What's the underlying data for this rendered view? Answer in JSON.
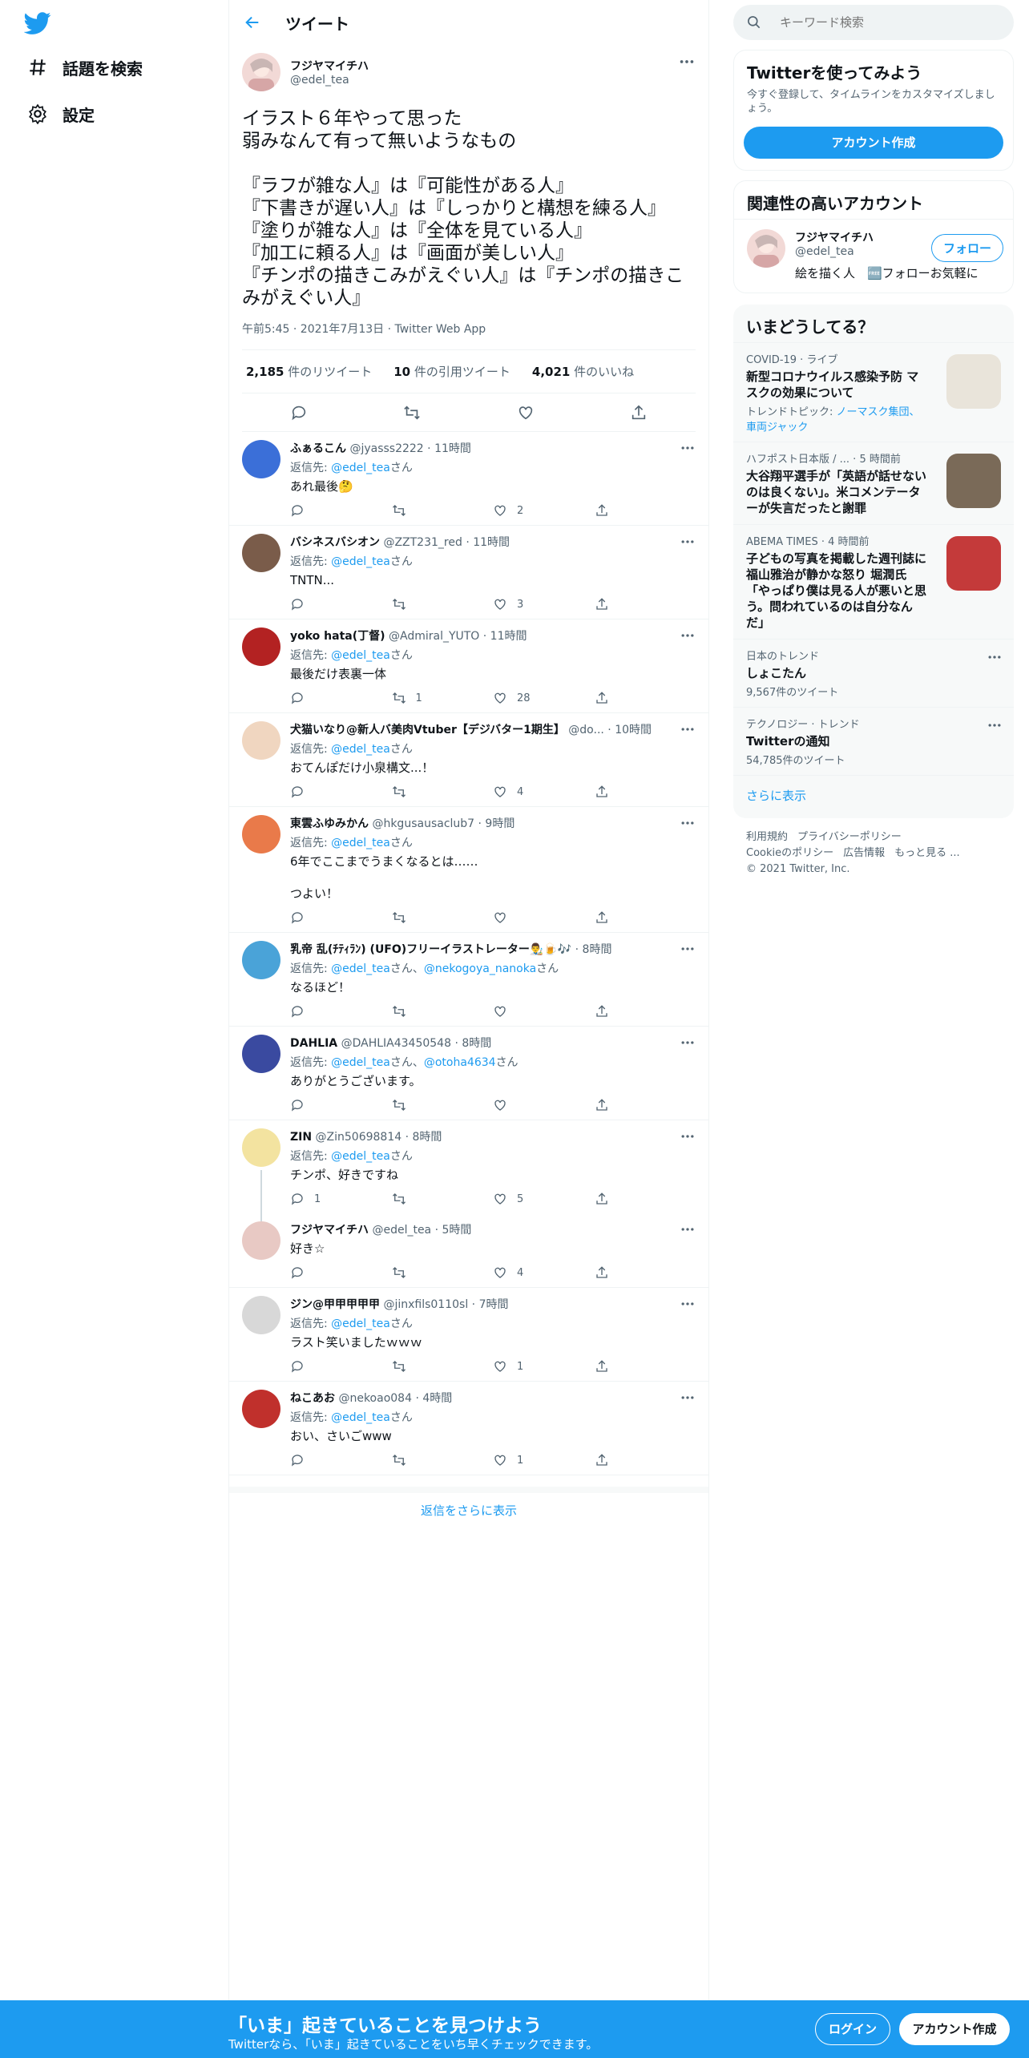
{
  "nav": {
    "explore": "話題を検索",
    "settings": "設定"
  },
  "header": {
    "title": "ツイート"
  },
  "tweet": {
    "display_name": "フジヤマイチハ",
    "handle": "@edel_tea",
    "text": "イラスト６年やって思った\n弱みなんて有って無いようなもの\n\n『ラフが雑な人』は『可能性がある人』\n『下書きが遅い人』は『しっかりと構想を練る人』\n『塗りが雑な人』は『全体を見ている人』\n『加工に頼る人』は『画面が美しい人』\n『チンポの描きこみがえぐい人』は『チンポの描きこみがえぐい人』",
    "timestamp": "午前5:45 · 2021年7月13日 · Twitter Web App",
    "retweets": "2,185",
    "retweets_label": "件のリツイート",
    "quotes": "10",
    "quotes_label": "件の引用ツイート",
    "likes": "4,021",
    "likes_label": "件のいいね"
  },
  "replies": [
    {
      "name": "ふぁるこん",
      "handle": "@jyasss2222",
      "time": "· 11時間",
      "reply_prefix": "返信先:",
      "reply_to": "@edel_tea",
      "reply_to2": "",
      "reply_suffix": "さん",
      "text": "あれ最後🤔",
      "replies": "",
      "retweets": "",
      "likes": "2"
    },
    {
      "name": "バシネスバシオン",
      "handle": "@ZZT231_red",
      "time": "· 11時間",
      "reply_prefix": "返信先:",
      "reply_to": "@edel_tea",
      "reply_to2": "",
      "reply_suffix": "さん",
      "text": "TNTN...",
      "replies": "",
      "retweets": "",
      "likes": "3"
    },
    {
      "name": "yoko hata(丁督)",
      "handle": "@Admiral_YUTO",
      "time": "· 11時間",
      "reply_prefix": "返信先:",
      "reply_to": "@edel_tea",
      "reply_to2": "",
      "reply_suffix": "さん",
      "text": "最後だけ表裏一体",
      "replies": "",
      "retweets": "1",
      "likes": "28"
    },
    {
      "name": "犬猫いなり@新人バ美肉Vtuber【デジバター1期生】",
      "handle": "@do...",
      "time": "· 10時間",
      "reply_prefix": "返信先:",
      "reply_to": "@edel_tea",
      "reply_to2": "",
      "reply_suffix": "さん",
      "text": "おてんぽだけ小泉構文...！",
      "replies": "",
      "retweets": "",
      "likes": "4"
    },
    {
      "name": "東雲ふゆみかん",
      "handle": "@hkgusausaclub7",
      "time": "· 9時間",
      "reply_prefix": "返信先:",
      "reply_to": "@edel_tea",
      "reply_to2": "",
      "reply_suffix": "さん",
      "text": "6年でここまでうまくなるとは……\n\nつよい！",
      "replies": "",
      "retweets": "",
      "likes": ""
    },
    {
      "name": "乳帝 乱(ﾁﾃｨﾗﾝ) (UFO)フリーイラストレーター👨‍🎨🍺🎶",
      "handle": "",
      "time": "· 8時間",
      "reply_prefix": "返信先:",
      "reply_to": "@edel_tea",
      "reply_to2": "@nekogoya_nanoka",
      "reply_suffix": "さん",
      "text": "なるほど！",
      "replies": "",
      "retweets": "",
      "likes": ""
    },
    {
      "name": "DAHLIA",
      "handle": "@DAHLIA43450548",
      "time": "· 8時間",
      "reply_prefix": "返信先:",
      "reply_to": "@edel_tea",
      "reply_to2": "@otoha4634",
      "reply_suffix": "さん",
      "text": "ありがとうございます。",
      "replies": "",
      "retweets": "",
      "likes": ""
    },
    {
      "name": "ZIN",
      "handle": "@Zin50698814",
      "time": "· 8時間",
      "reply_prefix": "返信先:",
      "reply_to": "@edel_tea",
      "reply_to2": "",
      "reply_suffix": "さん",
      "text": "チンポ、好きですね",
      "replies": "1",
      "retweets": "",
      "likes": "5"
    },
    {
      "name": "フジヤマイチハ",
      "handle": "@edel_tea",
      "time": "· 5時間",
      "reply_prefix": "",
      "reply_to": "",
      "reply_to2": "",
      "reply_suffix": "",
      "text": "好き☆",
      "replies": "",
      "retweets": "",
      "likes": "4"
    },
    {
      "name": "ジン@甲甲甲甲甲",
      "handle": "@jinxfils0110sl",
      "time": "· 7時間",
      "reply_prefix": "返信先:",
      "reply_to": "@edel_tea",
      "reply_to2": "",
      "reply_suffix": "さん",
      "text": "ラスト笑いましたｗｗｗ",
      "replies": "",
      "retweets": "",
      "likes": "1"
    },
    {
      "name": "ねこあお",
      "handle": "@nekoao084",
      "time": "· 4時間",
      "reply_prefix": "返信先:",
      "reply_to": "@edel_tea",
      "reply_to2": "",
      "reply_suffix": "さん",
      "text": "おい、さいごwww",
      "replies": "",
      "retweets": "",
      "likes": "1"
    }
  ],
  "show_more_replies": "返信をさらに表示",
  "search": {
    "placeholder": "キーワード検索"
  },
  "signup_card": {
    "title": "Twitterを使ってみよう",
    "subtitle": "今すぐ登録して、タイムラインをカスタマイズしましょう。",
    "button": "アカウント作成"
  },
  "related": {
    "title": "関連性の高いアカウント",
    "name": "フジヤマイチハ",
    "handle": "@edel_tea",
    "follow": "フォロー",
    "bio": "絵を描く人　🆓フォローお気軽に"
  },
  "trends": {
    "title": "いまどうしてる？",
    "items": [
      {
        "meta": "COVID-19 · ライブ",
        "title": "新型コロナウイルス感染予防 マスクの効果について",
        "sub_prefix": "トレンドトピック: ",
        "sub_link": "ノーマスク集団、車両ジャック"
      },
      {
        "meta": "ハフポスト日本版 / ... · 5 時間前",
        "title": "大谷翔平選手が「英語が話せないのは良くない」。米コメンテーターが失言だったと謝罪",
        "sub_prefix": "",
        "sub_link": ""
      },
      {
        "meta": "ABEMA TIMES · 4 時間前",
        "title": "子どもの写真を掲載した週刊誌に福山雅治が静かな怒り 堀潤氏「やっぱり僕は見る人が悪いと思う。問われているのは自分なんだ」",
        "sub_prefix": "",
        "sub_link": ""
      },
      {
        "meta": "日本のトレンド",
        "title": "しょこたん",
        "sub_prefix": "9,567件のツイート",
        "sub_link": ""
      },
      {
        "meta": "テクノロジー · トレンド",
        "title": "Twitterの通知",
        "sub_prefix": "54,785件のツイート",
        "sub_link": ""
      }
    ],
    "show_more": "さらに表示"
  },
  "footer": {
    "terms": "利用規約",
    "privacy": "プライバシーポリシー",
    "cookie": "Cookieのポリシー",
    "ads": "広告情報",
    "more": "もっと見る ...",
    "copyright": "© 2021 Twitter, Inc."
  },
  "banner": {
    "title": "「いま」起きていることを見つけよう",
    "subtitle": "Twitterなら、「いま」起きていることをいち早くチェックできます。",
    "login": "ログイン",
    "signup": "アカウント作成"
  },
  "colors": {
    "accent": "#1d9bf0",
    "text": "#0f1419",
    "muted": "#536471",
    "border": "#eff3f4"
  }
}
